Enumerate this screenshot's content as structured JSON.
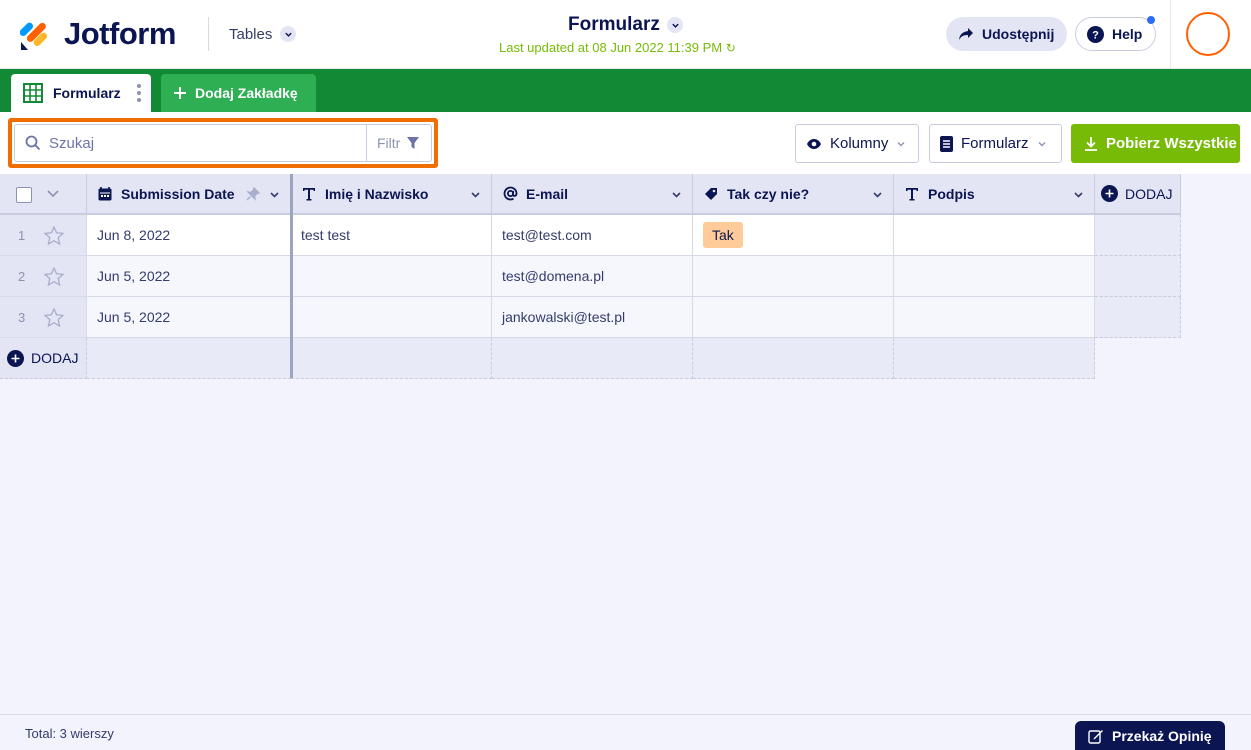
{
  "header": {
    "brand": "Jotform",
    "app_switcher": "Tables",
    "title": "Formularz",
    "last_updated": "Last updated at 08 Jun 2022 11:39 PM",
    "share_label": "Udostępnij",
    "help_label": "Help"
  },
  "tabs": {
    "active_label": "Formularz",
    "add_label": "Dodaj Zakładkę"
  },
  "toolbar": {
    "search_placeholder": "Szukaj",
    "filter_label": "Filtr",
    "columns_label": "Kolumny",
    "form_label": "Formularz",
    "download_label": "Pobierz Wszystkie"
  },
  "table": {
    "columns": [
      {
        "label": "Submission Date",
        "icon": "calendar-icon"
      },
      {
        "label": "Imię i Nazwisko",
        "icon": "text-icon"
      },
      {
        "label": "E-mail",
        "icon": "at-icon"
      },
      {
        "label": "Tak czy nie?",
        "icon": "tag-icon"
      },
      {
        "label": "Podpis",
        "icon": "text-icon"
      }
    ],
    "add_column_label": "DODAJ",
    "add_row_label": "DODAJ",
    "rows": [
      {
        "num": "1",
        "date": "Jun 8, 2022",
        "name": "test test",
        "email": "test@test.com",
        "choice": "Tak",
        "signature": ""
      },
      {
        "num": "2",
        "date": "Jun 5, 2022",
        "name": "",
        "email": "test@domena.pl",
        "choice": "",
        "signature": ""
      },
      {
        "num": "3",
        "date": "Jun 5, 2022",
        "name": "",
        "email": "jankowalski@test.pl",
        "choice": "",
        "signature": ""
      }
    ]
  },
  "footer": {
    "total": "Total: 3 wierszy",
    "feedback_label": "Przekaż Opinię"
  },
  "colors": {
    "brand_navy": "#0a1551",
    "tab_bar_green": "#128a35",
    "add_tab_green": "#2eaf54",
    "download_green": "#78bb07",
    "search_highlight": "#f06e00",
    "tag_peach": "#ffcc99"
  }
}
